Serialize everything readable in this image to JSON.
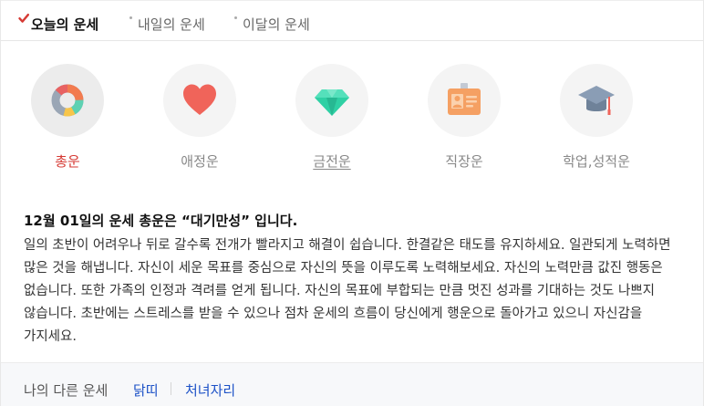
{
  "tabs": [
    {
      "label": "오늘의 운세",
      "active": true
    },
    {
      "label": "내일의 운세",
      "active": false
    },
    {
      "label": "이달의 운세",
      "active": false
    }
  ],
  "categories": [
    {
      "label": "총운",
      "icon": "donut-chart-icon",
      "active": true
    },
    {
      "label": "애정운",
      "icon": "heart-icon",
      "active": false
    },
    {
      "label": "금전운",
      "icon": "diamond-icon",
      "active": false
    },
    {
      "label": "직장운",
      "icon": "id-badge-icon",
      "active": false
    },
    {
      "label": "학업,성적운",
      "icon": "graduation-cap-icon",
      "active": false
    }
  ],
  "fortune": {
    "headline": "12월 01일의 운세 총운은 “대기만성” 입니다.",
    "body": "일의 초반이 어려우나 뒤로 갈수록 전개가 빨라지고 해결이 쉽습니다. 한결같은 태도를 유지하세요. 일관되게 노력하면 많은 것을 해냅니다. 자신이 세운 목표를 중심으로 자신의 뜻을 이루도록 노력해보세요. 자신의 노력만큼 값진 행동은 없습니다. 또한 가족의 인정과 격려를 얻게 됩니다. 자신의 목표에 부합되는 만큼 멋진 성과를 기대하는 것도 나쁘지 않습니다. 초반에는 스트레스를 받을 수 있으나 점차 운세의 흐름이 당신에게 행운으로 돌아가고 있으니 자신감을 가지세요."
  },
  "footer": {
    "label": "나의 다른 운세",
    "links": [
      "닭띠",
      "처녀자리"
    ]
  },
  "colors": {
    "accent_red": "#d63a34",
    "link_blue": "#1d52c7",
    "heart": "#f0645a",
    "diamond": "#2fd0a4",
    "badge": "#f5a063",
    "cap": "#8a9db5"
  }
}
